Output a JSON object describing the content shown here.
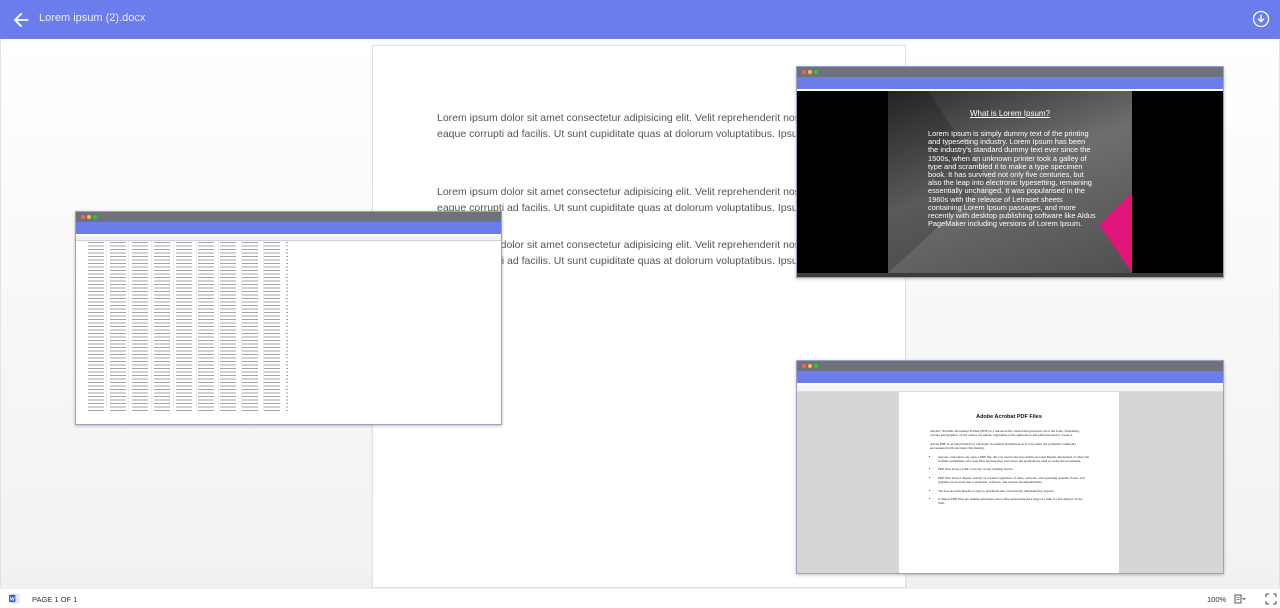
{
  "header": {
    "title": "Lorem ipsum (2).docx",
    "background": "#6b7ded"
  },
  "document": {
    "paragraphs": [
      "Lorem ipsum dolor sit amet consectetur adipisicing elit. Velit reprehenderit nostrum nulla autem, quo eaque corrupti ad facilis. Ut sunt cupiditate quas at dolorum voluptatibus. Ipsum, nemo facilis.",
      "Lorem ipsum dolor sit amet consectetur adipisicing elit. Velit reprehenderit nostrum nulla autem, quo eaque corrupti ad facilis. Ut sunt cupiditate quas at dolorum voluptatibus. Ipsum, nemo facilis.",
      "Lorem ipsum dolor sit amet consectetur adipisicing elit. Velit reprehenderit nostrum nulla autem, quo eaque corrupti ad facilis. Ut sunt cupiditate quas at dolorum voluptatibus. Ipsum, nemo facilis."
    ]
  },
  "slide_window": {
    "heading": "What is Lorem Ipsum?",
    "body": "Lorem Ipsum is simply dummy text of the printing and typesetting industry. Lorem Ipsum has been the industry's standard dummy text ever since the 1500s, when an unknown printer took a galley of type and scrambled it to make a type specimen book. It has survived not only five centuries, but also the leap into electronic typesetting, remaining essentially unchanged. It was popularised in the 1960s with the release of Letraset sheets containing Lorem Ipsum passages, and more recently with desktop publishing software like Aldus PageMaker including versions of Lorem Ipsum."
  },
  "pdf_window": {
    "heading": "Adobe Acrobat PDF Files",
    "paragraphs": [
      "Adobe® Portable Document Format (PDF) is a universal file format that preserves all of the fonts, formatting, colours and graphics of any source document, regardless of the application and platform used to create it.",
      "Adobe PDF is an ideal format for electronic document distribution as it overcomes the problems commonly encountered with electronic file sharing."
    ],
    "bullets": [
      "Anyone, anywhere can open a PDF file. All you need is the free Adobe Acrobat Reader. Recipients of other file formats sometimes can't open files because they don't have the applications used to create the documents.",
      "PDF files always print correctly on any printing device.",
      "PDF files always display exactly as created, regardless of fonts, software, and operating systems. Fonts, and graphics are not lost due to platform, software, and version incompatibilities.",
      "The free Acrobat Reader is easy to download and can be freely distributed by anyone.",
      "Compact PDF files are smaller than their source files and download a page at a time for fast display on the Web."
    ]
  },
  "footer": {
    "page_count": "PAGE 1 OF 1",
    "zoom": "100%"
  }
}
